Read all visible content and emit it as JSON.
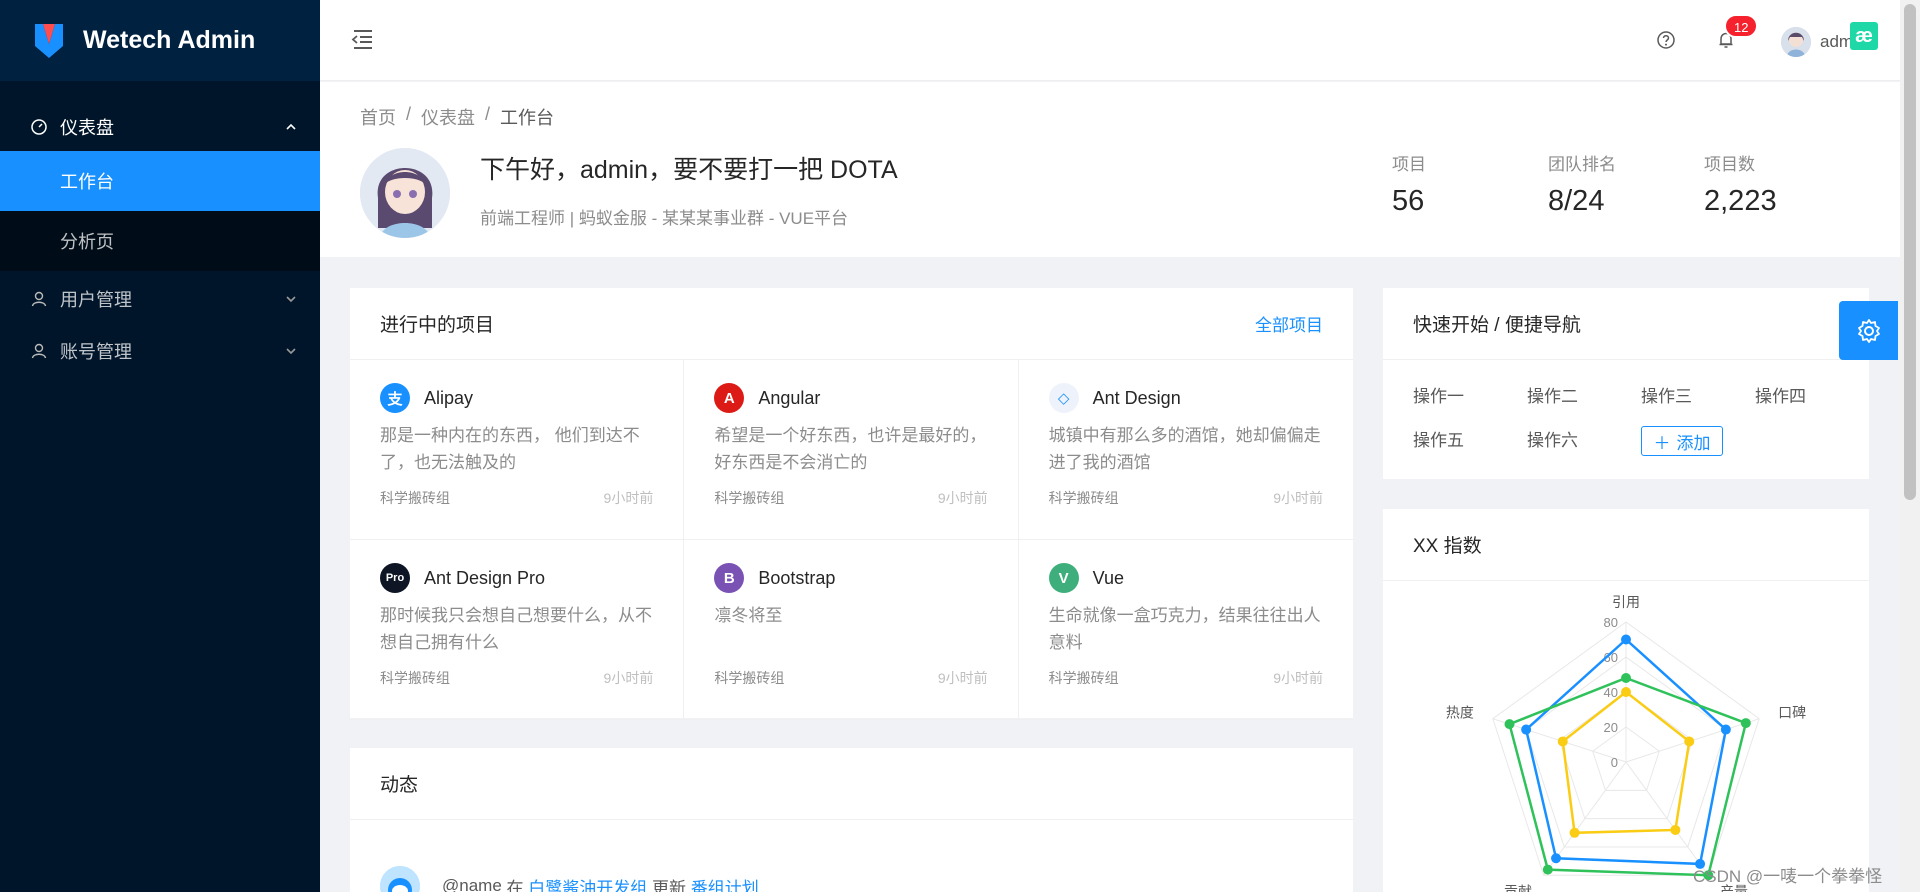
{
  "app": {
    "title": "Wetech Admin"
  },
  "sidebar": {
    "dashboard": "仪表盘",
    "workbench": "工作台",
    "analysis": "分析页",
    "users": "用户管理",
    "accounts": "账号管理"
  },
  "header": {
    "notification_count": "12",
    "user_name": "admin",
    "corner_badge": "æ"
  },
  "breadcrumb": [
    "首页",
    "/",
    "仪表盘",
    "/",
    "工作台"
  ],
  "profile": {
    "greeting": "下午好，admin，要不要打一把 DOTA",
    "subtitle": "前端工程师 | 蚂蚁金服 - 某某某事业群 - VUE平台"
  },
  "stats": [
    {
      "label": "项目",
      "value": "56"
    },
    {
      "label": "团队排名",
      "value": "8/24"
    },
    {
      "label": "项目数",
      "value": "2,223"
    }
  ],
  "projects_card": {
    "title": "进行中的项目",
    "all_link": "全部项目",
    "items": [
      {
        "name": "Alipay",
        "desc": "那是一种内在的东西， 他们到达不了，也无法触及的",
        "group": "科学搬砖组",
        "time": "9小时前",
        "logo_text": "支",
        "color": "#1890ff"
      },
      {
        "name": "Angular",
        "desc": "希望是一个好东西，也许是最好的，好东西是不会消亡的",
        "group": "科学搬砖组",
        "time": "9小时前",
        "logo_text": "A",
        "color": "#dd1b16"
      },
      {
        "name": "Ant Design",
        "desc": "城镇中有那么多的酒馆，她却偏偏走进了我的酒馆",
        "group": "科学搬砖组",
        "time": "9小时前",
        "logo_text": "◇",
        "color": "#e6f0ff"
      },
      {
        "name": "Ant Design Pro",
        "desc": "那时候我只会想自己想要什么，从不想自己拥有什么",
        "group": "科学搬砖组",
        "time": "9小时前",
        "logo_text": "Pro",
        "color": "#0e1525"
      },
      {
        "name": "Bootstrap",
        "desc": "凛冬将至",
        "group": "科学搬砖组",
        "time": "9小时前",
        "logo_text": "B",
        "color": "#7952b3"
      },
      {
        "name": "Vue",
        "desc": "生命就像一盒巧克力，结果往往出人意料",
        "group": "科学搬砖组",
        "time": "9小时前",
        "logo_text": "V",
        "color": "#3eaf7c"
      }
    ]
  },
  "quick_card": {
    "title": "快速开始 / 便捷导航",
    "items": [
      "操作一",
      "操作二",
      "操作三",
      "操作四",
      "操作五",
      "操作六"
    ],
    "add_label": "添加"
  },
  "index_card": {
    "title": "XX 指数"
  },
  "chart_data": {
    "type": "radar",
    "indicators": [
      "引用",
      "口碑",
      "产量",
      "贡献",
      "热度"
    ],
    "max": 80,
    "ticks": [
      "80",
      "60",
      "40",
      "20",
      "0"
    ],
    "series": [
      {
        "values": [
          70,
          60,
          72,
          68,
          60
        ],
        "color": "#1890ff"
      },
      {
        "values": [
          48,
          72,
          80,
          76,
          70
        ],
        "color": "#2fc25b"
      },
      {
        "values": [
          40,
          38,
          48,
          50,
          38
        ],
        "color": "#facc14"
      }
    ]
  },
  "dynamics_card": {
    "title": "动态",
    "entry": {
      "user": "@name",
      "prefix": "在",
      "group": "白鹭酱油开发组",
      "action": "更新",
      "target": "番组计划"
    }
  },
  "watermark": "CSDN @一唛一个拳拳怪"
}
